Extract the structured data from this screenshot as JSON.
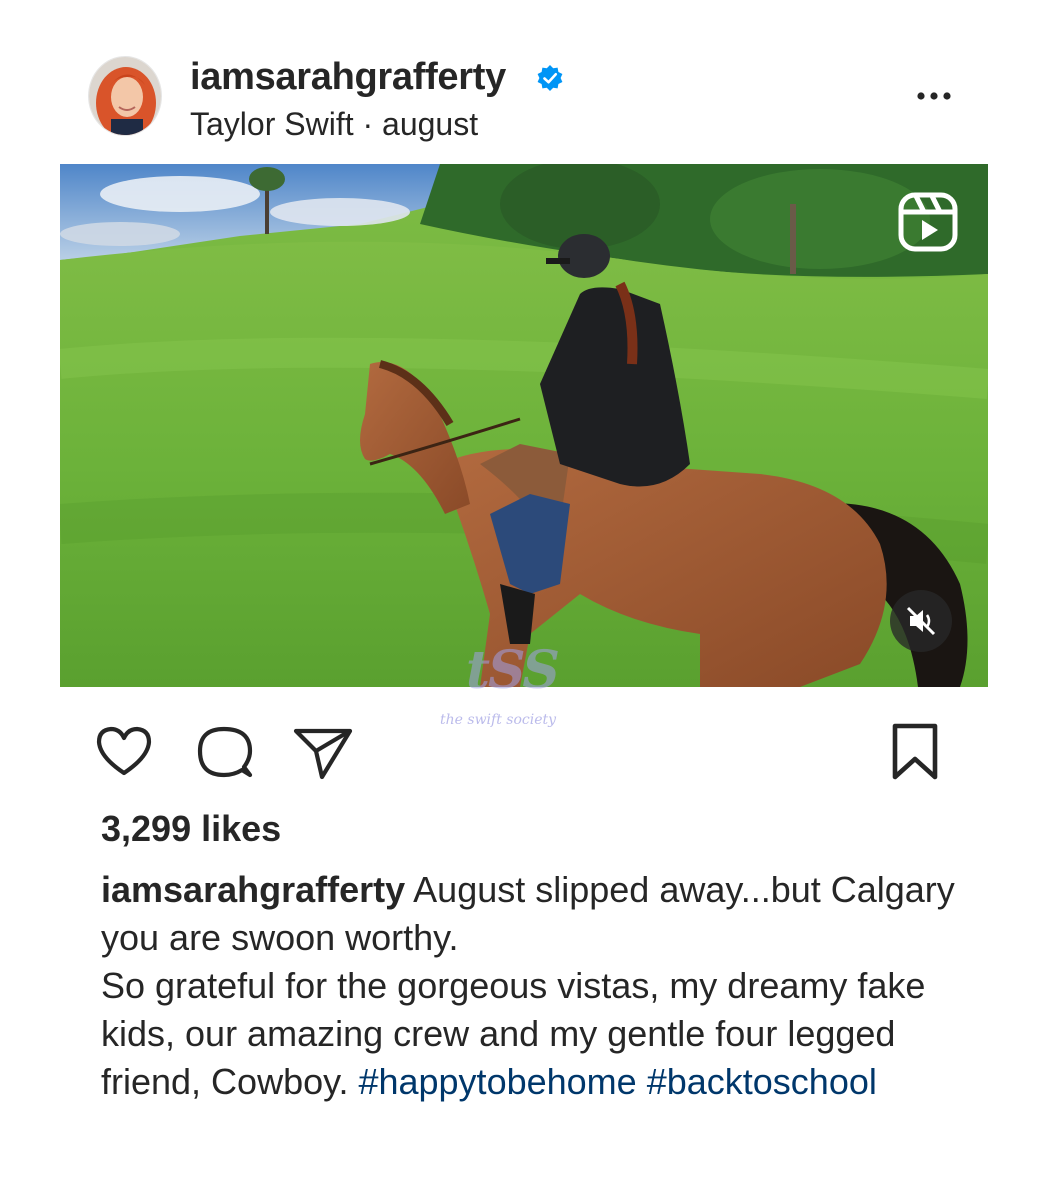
{
  "post": {
    "username": "iamsarahgrafferty",
    "verified": true,
    "audio": "Taylor Swift",
    "separator": " · ",
    "track": "august",
    "more_icon": "more-horizontal-icon",
    "media_badge_icon": "reels-icon",
    "mute_icon": "speaker-muted-icon",
    "watermark": {
      "mark": "tSS",
      "text": "the swift society"
    },
    "actions": {
      "like_icon": "heart-icon",
      "comment_icon": "comment-bubble-icon",
      "share_icon": "paper-plane-icon",
      "save_icon": "bookmark-icon"
    },
    "likes": "3,299 likes",
    "caption": {
      "username": "iamsarahgrafferty",
      "line1": " August slipped away...but Calgary you are swoon worthy.",
      "line2": "So grateful for the gorgeous vistas, my dreamy fake kids, our amazing crew and my gentle four legged friend,  Cowboy. ",
      "hashtags": [
        "#happytobehome",
        "#backtoschool"
      ]
    }
  },
  "colors": {
    "text": "#262626",
    "hashtag": "#00376b",
    "verified_badge": "#0095f6",
    "background": "#ffffff"
  }
}
